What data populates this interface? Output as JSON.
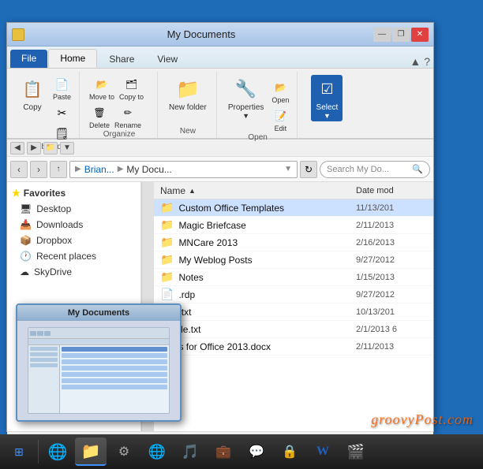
{
  "window": {
    "title": "My Documents",
    "icon": "folder-icon"
  },
  "titlebar": {
    "minimize": "—",
    "maximize": "❐",
    "close": "✕"
  },
  "ribbon": {
    "tabs": [
      {
        "label": "File",
        "active": false,
        "file": true
      },
      {
        "label": "Home",
        "active": true
      },
      {
        "label": "Share"
      },
      {
        "label": "View"
      }
    ],
    "groups": {
      "clipboard": {
        "label": "Clipboard",
        "buttons": [
          {
            "label": "Copy",
            "icon": "📋"
          },
          {
            "label": "Paste",
            "icon": "📄"
          }
        ]
      },
      "organize": {
        "label": "Organize"
      },
      "new": {
        "label": "New",
        "button": "New folder"
      },
      "open": {
        "label": "Open",
        "button": "Properties"
      },
      "select": {
        "label": "Select",
        "button": "Select",
        "active": true
      }
    }
  },
  "navbar": {
    "back": "‹",
    "forward": "›",
    "up": "↑",
    "path": [
      {
        "label": "Brian...",
        "link": true
      },
      {
        "label": "My Docu...",
        "link": false
      }
    ],
    "search_placeholder": "Search My Do...",
    "refresh": "↻"
  },
  "quickaccess": {
    "folder_icon": "📁",
    "arrow": "▼"
  },
  "sidebar": {
    "favorites_label": "Favorites",
    "items": [
      {
        "label": "Desktop",
        "icon": "🖥"
      },
      {
        "label": "Downloads",
        "icon": "📥"
      },
      {
        "label": "Dropbox",
        "icon": "📦"
      },
      {
        "label": "Recent places",
        "icon": "🕐"
      },
      {
        "label": "SkyDrive",
        "icon": "☁"
      }
    ]
  },
  "filelist": {
    "columns": [
      {
        "label": "Name",
        "sort": "▲"
      },
      {
        "label": "Date mod"
      }
    ],
    "files": [
      {
        "name": "Custom Office Templates",
        "date": "11/13/201",
        "type": "folder",
        "selected": true
      },
      {
        "name": "Magic Briefcase",
        "date": "2/11/2013",
        "type": "folder"
      },
      {
        "name": "MNCare 2013",
        "date": "2/16/2013",
        "type": "folder"
      },
      {
        "name": "My Weblog Posts",
        "date": "9/27/2012",
        "type": "folder"
      },
      {
        "name": "Notes",
        "date": "1/15/2013",
        "type": "folder"
      },
      {
        "name": ".rdp",
        "date": "9/27/2012",
        "type": "file"
      },
      {
        "name": ".txt",
        "date": "10/13/201",
        "type": "file"
      },
      {
        "name": "ile.txt",
        "date": "2/1/2013 6",
        "type": "file"
      },
      {
        "name": "s for Office 2013.docx",
        "date": "2/11/2013",
        "type": "file"
      }
    ]
  },
  "thumbnail": {
    "title": "My Documents",
    "visible": true
  },
  "taskbar": {
    "items": [
      {
        "icon": "🌐",
        "label": "internet-explorer"
      },
      {
        "icon": "📁",
        "label": "file-explorer",
        "active": true
      },
      {
        "icon": "⚙",
        "label": "windows-icon"
      },
      {
        "icon": "🌐",
        "label": "chrome"
      },
      {
        "icon": "🎵",
        "label": "media-player"
      },
      {
        "icon": "💼",
        "label": "outlook"
      },
      {
        "icon": "💬",
        "label": "skype"
      },
      {
        "icon": "🔒",
        "label": "lastpass"
      },
      {
        "icon": "W",
        "label": "word"
      },
      {
        "icon": "🎬",
        "label": "vlc"
      }
    ]
  },
  "watermark": {
    "prefix": "groovy",
    "suffix": "Post.com"
  },
  "statusbar": {
    "view1": "⊞",
    "view2": "☰"
  }
}
